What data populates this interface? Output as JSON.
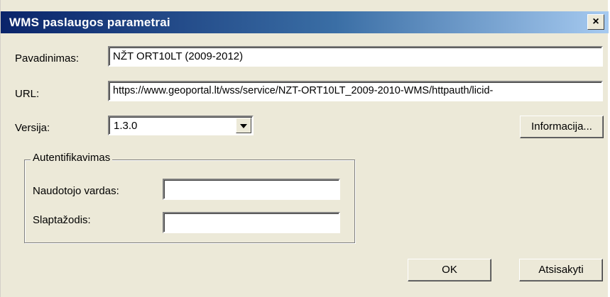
{
  "window": {
    "title": "WMS paslaugos parametrai",
    "close_symbol": "×"
  },
  "fields": {
    "name_label": "Pavadinimas:",
    "name_value": "NŽT ORT10LT (2009-2012)",
    "url_label": "URL:",
    "url_value": "https://www.geoportal.lt/wss/service/NZT-ORT10LT_2009-2010-WMS/httpauth/licid-",
    "version_label": "Versija:",
    "version_value": "1.3.0"
  },
  "buttons": {
    "info": "Informacija...",
    "ok": "OK",
    "cancel": "Atsisakyti"
  },
  "auth": {
    "group_label": "Autentifikavimas",
    "username_label": "Naudotojo vardas:",
    "username_value": "",
    "password_label": "Slaptažodis:",
    "password_value": ""
  }
}
